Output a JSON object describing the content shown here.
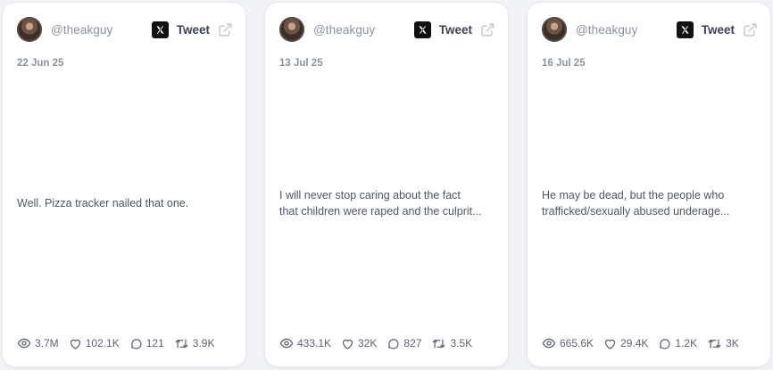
{
  "cards": [
    {
      "handle": "@theakguy",
      "tweet_label": "Tweet",
      "date": "22 Jun 25",
      "text_lines": [
        "Well. Pizza tracker nailed that one."
      ],
      "stats": {
        "views": "3.7M",
        "likes": "102.1K",
        "replies": "121",
        "retweets": "3.9K"
      }
    },
    {
      "handle": "@theakguy",
      "tweet_label": "Tweet",
      "date": "13 Jul 25",
      "text_lines": [
        "I will never stop caring about the fact",
        "that children were raped and the culprit..."
      ],
      "stats": {
        "views": "433.1K",
        "likes": "32K",
        "replies": "827",
        "retweets": "3.5K"
      }
    },
    {
      "handle": "@theakguy",
      "tweet_label": "Tweet",
      "date": "16 Jul 25",
      "text_lines": [
        "He may be dead, but the people who",
        "trafficked/sexually abused underage..."
      ],
      "stats": {
        "views": "665.6K",
        "likes": "29.4K",
        "replies": "1.2K",
        "retweets": "3K"
      }
    }
  ],
  "icons": {
    "x_logo": "x-logo-icon",
    "external": "external-link-icon",
    "views": "eye-icon",
    "likes": "heart-icon",
    "replies": "comment-icon",
    "retweets": "retweet-icon"
  },
  "colors": {
    "background": "#f1f3f6",
    "card": "#ffffff",
    "muted_text": "#8c939c",
    "body_text": "#4f5661"
  }
}
